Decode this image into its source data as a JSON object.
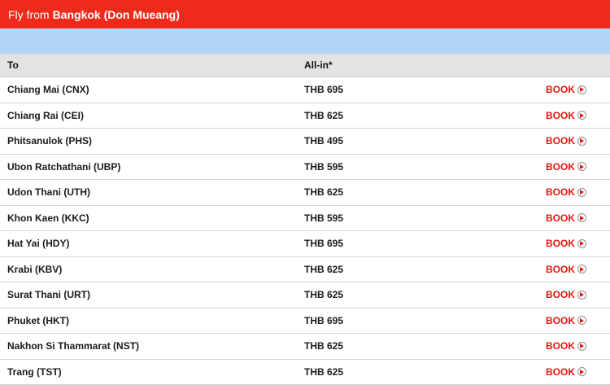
{
  "header": {
    "lead": "Fly from",
    "origin": "Bangkok (Don Mueang)"
  },
  "columns": {
    "to": "To",
    "price": "All-in*"
  },
  "book_label": "BOOK",
  "icons": {
    "arrow": "play-circle-icon"
  },
  "colors": {
    "header": "#ee2b1b",
    "band": "#b2d4f7",
    "book": "#e8160c"
  },
  "routes": [
    {
      "destination": "Chiang Mai (CNX)",
      "price": "THB 695"
    },
    {
      "destination": "Chiang Rai (CEI)",
      "price": "THB 625"
    },
    {
      "destination": "Phitsanulok (PHS)",
      "price": "THB 495"
    },
    {
      "destination": "Ubon Ratchathani (UBP)",
      "price": "THB 595"
    },
    {
      "destination": "Udon Thani (UTH)",
      "price": "THB 625"
    },
    {
      "destination": "Khon Kaen (KKC)",
      "price": "THB 595"
    },
    {
      "destination": "Hat Yai (HDY)",
      "price": "THB 695"
    },
    {
      "destination": "Krabi (KBV)",
      "price": "THB 625"
    },
    {
      "destination": "Surat Thani (URT)",
      "price": "THB 625"
    },
    {
      "destination": "Phuket (HKT)",
      "price": "THB 695"
    },
    {
      "destination": "Nakhon Si Thammarat (NST)",
      "price": "THB 625"
    },
    {
      "destination": "Trang (TST)",
      "price": "THB 625"
    }
  ]
}
